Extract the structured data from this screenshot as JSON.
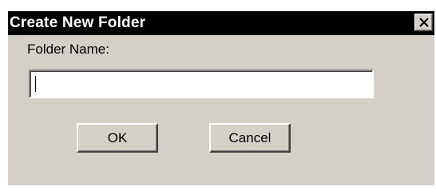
{
  "dialog": {
    "title": "Create New Folder",
    "close_icon": "close-icon",
    "field_label": "Folder Name:",
    "field_value": "",
    "ok_label": "OK",
    "cancel_label": "Cancel"
  },
  "colors": {
    "titlebar": "#000000",
    "title_text": "#ffffff",
    "face": "#d4d0c8"
  }
}
